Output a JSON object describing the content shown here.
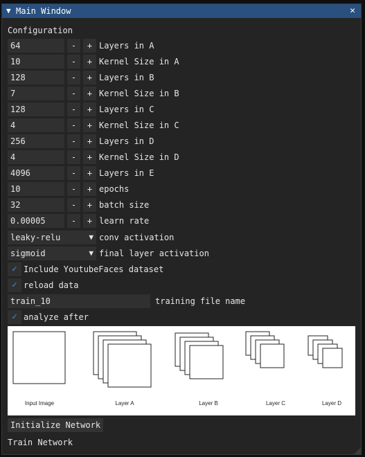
{
  "window": {
    "title": "Main Window",
    "collapse_icon": "▼",
    "close_icon": "✕",
    "title_color": "#29507f"
  },
  "section_title": "Configuration",
  "numeric_params": [
    {
      "value": "64",
      "label": "Layers in A"
    },
    {
      "value": "10",
      "label": "Kernel Size in A"
    },
    {
      "value": "128",
      "label": "Layers in B"
    },
    {
      "value": "7",
      "label": "Kernel Size in B"
    },
    {
      "value": "128",
      "label": "Layers in C"
    },
    {
      "value": "4",
      "label": "Kernel Size in C"
    },
    {
      "value": "256",
      "label": "Layers in D"
    },
    {
      "value": "4",
      "label": "Kernel Size in D"
    },
    {
      "value": "4096",
      "label": "Layers in E"
    },
    {
      "value": "10",
      "label": "epochs"
    },
    {
      "value": "32",
      "label": "batch size"
    },
    {
      "value": "0.00005",
      "label": "learn rate"
    }
  ],
  "stepper": {
    "minus": "-",
    "plus": "+"
  },
  "combos": [
    {
      "value": "leaky-relu",
      "label": "conv activation"
    },
    {
      "value": "sigmoid",
      "label": "final layer activation"
    }
  ],
  "combo_arrow": "▼",
  "checkboxes": {
    "youtube": {
      "label": "Include YoutubeFaces dataset",
      "checked": true
    },
    "reload": {
      "label": "reload data",
      "checked": true
    },
    "analyze": {
      "label": "analyze after",
      "checked": true
    }
  },
  "check_mark": "✓",
  "training_file": {
    "value": "train_10",
    "label": "training file name"
  },
  "diagram": {
    "labels": [
      "Input Image",
      "Layer A",
      "Layer B",
      "Layer C",
      "Layer D"
    ]
  },
  "buttons": {
    "initialize": "Initialize Network",
    "train": "Train Network"
  },
  "colors": {
    "accent": "#3d8be0",
    "frame": "#303030",
    "background": "#242424"
  }
}
